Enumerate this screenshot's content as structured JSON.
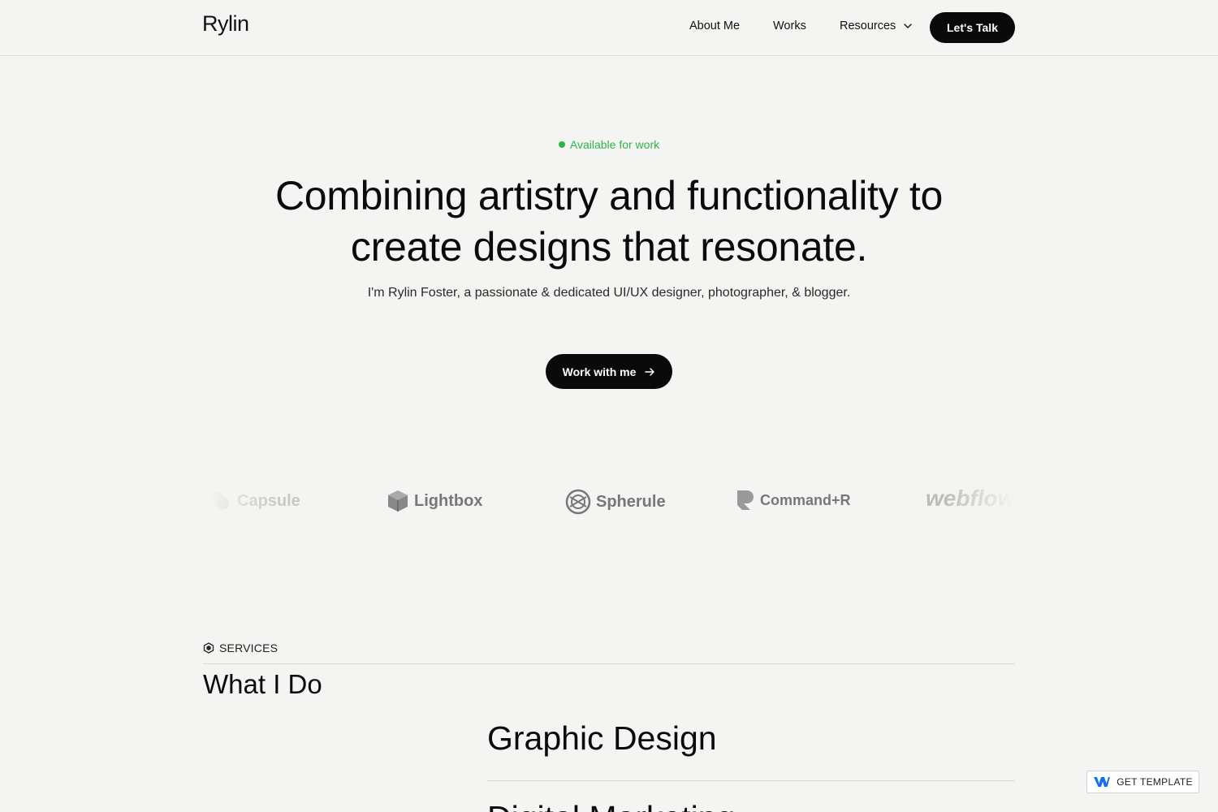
{
  "nav": {
    "logo": "Rylin",
    "links": [
      "About Me",
      "Works",
      "Resources"
    ],
    "cta": "Let's Talk"
  },
  "hero": {
    "status": "Available for work",
    "title_line1": "Combining artistry and functionality to",
    "title_line2": "create designs that resonate.",
    "subtitle": "I'm Rylin Foster, a passionate & dedicated UI/UX designer, photographer, & blogger.",
    "cta": "Work with me"
  },
  "logos": [
    "Capsule",
    "Lightbox",
    "Spherule",
    "Command+R",
    "webflow"
  ],
  "services": {
    "tag": "SERVICES",
    "title": "What I Do",
    "items": [
      "Graphic Design",
      "Digital Marketing"
    ]
  },
  "badge": {
    "label": "GET TEMPLATE"
  },
  "colors": {
    "background": "#f4f4f2",
    "primary": "#0a0a0a",
    "status": "#2fb34a",
    "webflow_blue": "#146ef5"
  }
}
